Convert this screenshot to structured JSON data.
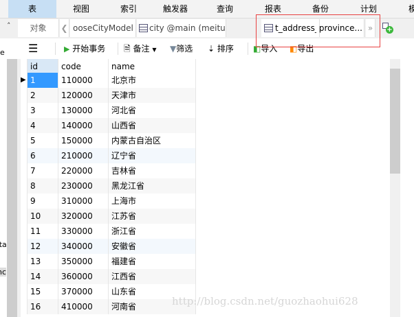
{
  "menu": [
    "表",
    "视图",
    "索引",
    "触发器",
    "查询",
    "报表",
    "备份",
    "计划",
    "模"
  ],
  "tabs": {
    "objects": "对象",
    "tab1": "ooseCityModel ...",
    "tab2": "city @main (meitua...",
    "tab3": "t_address_province..."
  },
  "toolbar": {
    "begin_transaction": "开始事务",
    "comment": "备注",
    "filter": "筛选",
    "sort": "排序",
    "import": "导入",
    "export": "导出"
  },
  "left_panel": [
    "e",
    "ata",
    "nc"
  ],
  "columns": [
    "id",
    "code",
    "name"
  ],
  "rows": [
    [
      "1",
      "110000",
      "北京市"
    ],
    [
      "2",
      "120000",
      "天津市"
    ],
    [
      "3",
      "130000",
      "河北省"
    ],
    [
      "4",
      "140000",
      "山西省"
    ],
    [
      "5",
      "150000",
      "内蒙古自治区"
    ],
    [
      "6",
      "210000",
      "辽宁省"
    ],
    [
      "7",
      "220000",
      "吉林省"
    ],
    [
      "8",
      "230000",
      "黑龙江省"
    ],
    [
      "9",
      "310000",
      "上海市"
    ],
    [
      "10",
      "320000",
      "江苏省"
    ],
    [
      "11",
      "330000",
      "浙江省"
    ],
    [
      "12",
      "340000",
      "安徽省"
    ],
    [
      "13",
      "350000",
      "福建省"
    ],
    [
      "14",
      "360000",
      "江西省"
    ],
    [
      "15",
      "370000",
      "山东省"
    ],
    [
      "16",
      "410000",
      "河南省"
    ]
  ],
  "watermark": "http://blog.csdn.net/guozhaohui628",
  "colors": {
    "selected_menu": "#c7dff4",
    "selected_cell": "#3399ff",
    "highlight_box": "#e84040"
  }
}
